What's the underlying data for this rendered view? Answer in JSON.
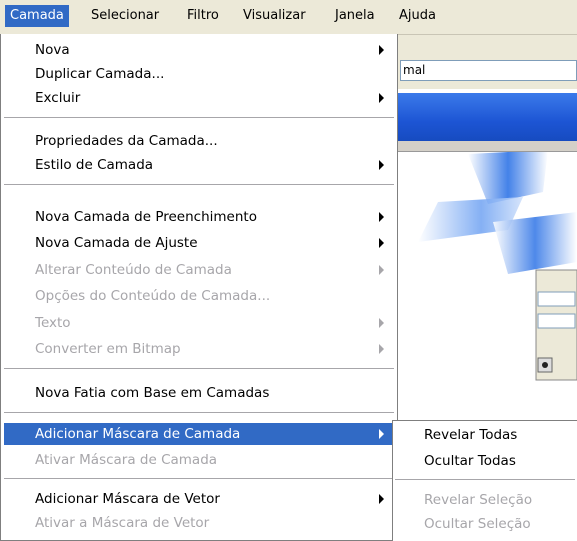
{
  "menubar": {
    "items": [
      {
        "label": "Camada",
        "active": true
      },
      {
        "label": "Selecionar"
      },
      {
        "label": "Filtro"
      },
      {
        "label": "Visualizar"
      },
      {
        "label": "Janela"
      },
      {
        "label": "Ajuda"
      }
    ]
  },
  "background": {
    "mode_value": "mal"
  },
  "menu": {
    "items": [
      {
        "label": "Nova",
        "submenu": true
      },
      {
        "label": "Duplicar Camada..."
      },
      {
        "label": "Excluir",
        "submenu": true
      },
      {
        "label": "Propriedades da Camada..."
      },
      {
        "label": "Estilo de Camada",
        "submenu": true
      },
      {
        "label": "Nova Camada de Preenchimento",
        "submenu": true
      },
      {
        "label": "Nova Camada de Ajuste",
        "submenu": true
      },
      {
        "label": "Alterar Conteúdo de Camada",
        "submenu": true,
        "disabled": true
      },
      {
        "label": "Opções do Conteúdo de Camada...",
        "disabled": true
      },
      {
        "label": "Texto",
        "submenu": true,
        "disabled": true
      },
      {
        "label": "Converter em Bitmap",
        "submenu": true,
        "disabled": true
      },
      {
        "label": "Nova Fatia com Base em Camadas"
      },
      {
        "label": "Adicionar Máscara de Camada",
        "submenu": true,
        "selected": true
      },
      {
        "label": "Ativar Máscara de Camada",
        "disabled": true
      },
      {
        "label": "Adicionar Máscara de Vetor",
        "submenu": true
      },
      {
        "label": "Ativar a Máscara de Vetor",
        "disabled": true
      }
    ]
  },
  "submenu": {
    "items": [
      {
        "label": "Revelar Todas"
      },
      {
        "label": "Ocultar Todas"
      },
      {
        "label": "Revelar Seleção",
        "disabled": true
      },
      {
        "label": "Ocultar Seleção",
        "disabled": true
      }
    ]
  },
  "colors": {
    "highlight": "#316ac5",
    "disabled_text": "#a7a6aa",
    "menubar_bg": "#ece9d8"
  }
}
